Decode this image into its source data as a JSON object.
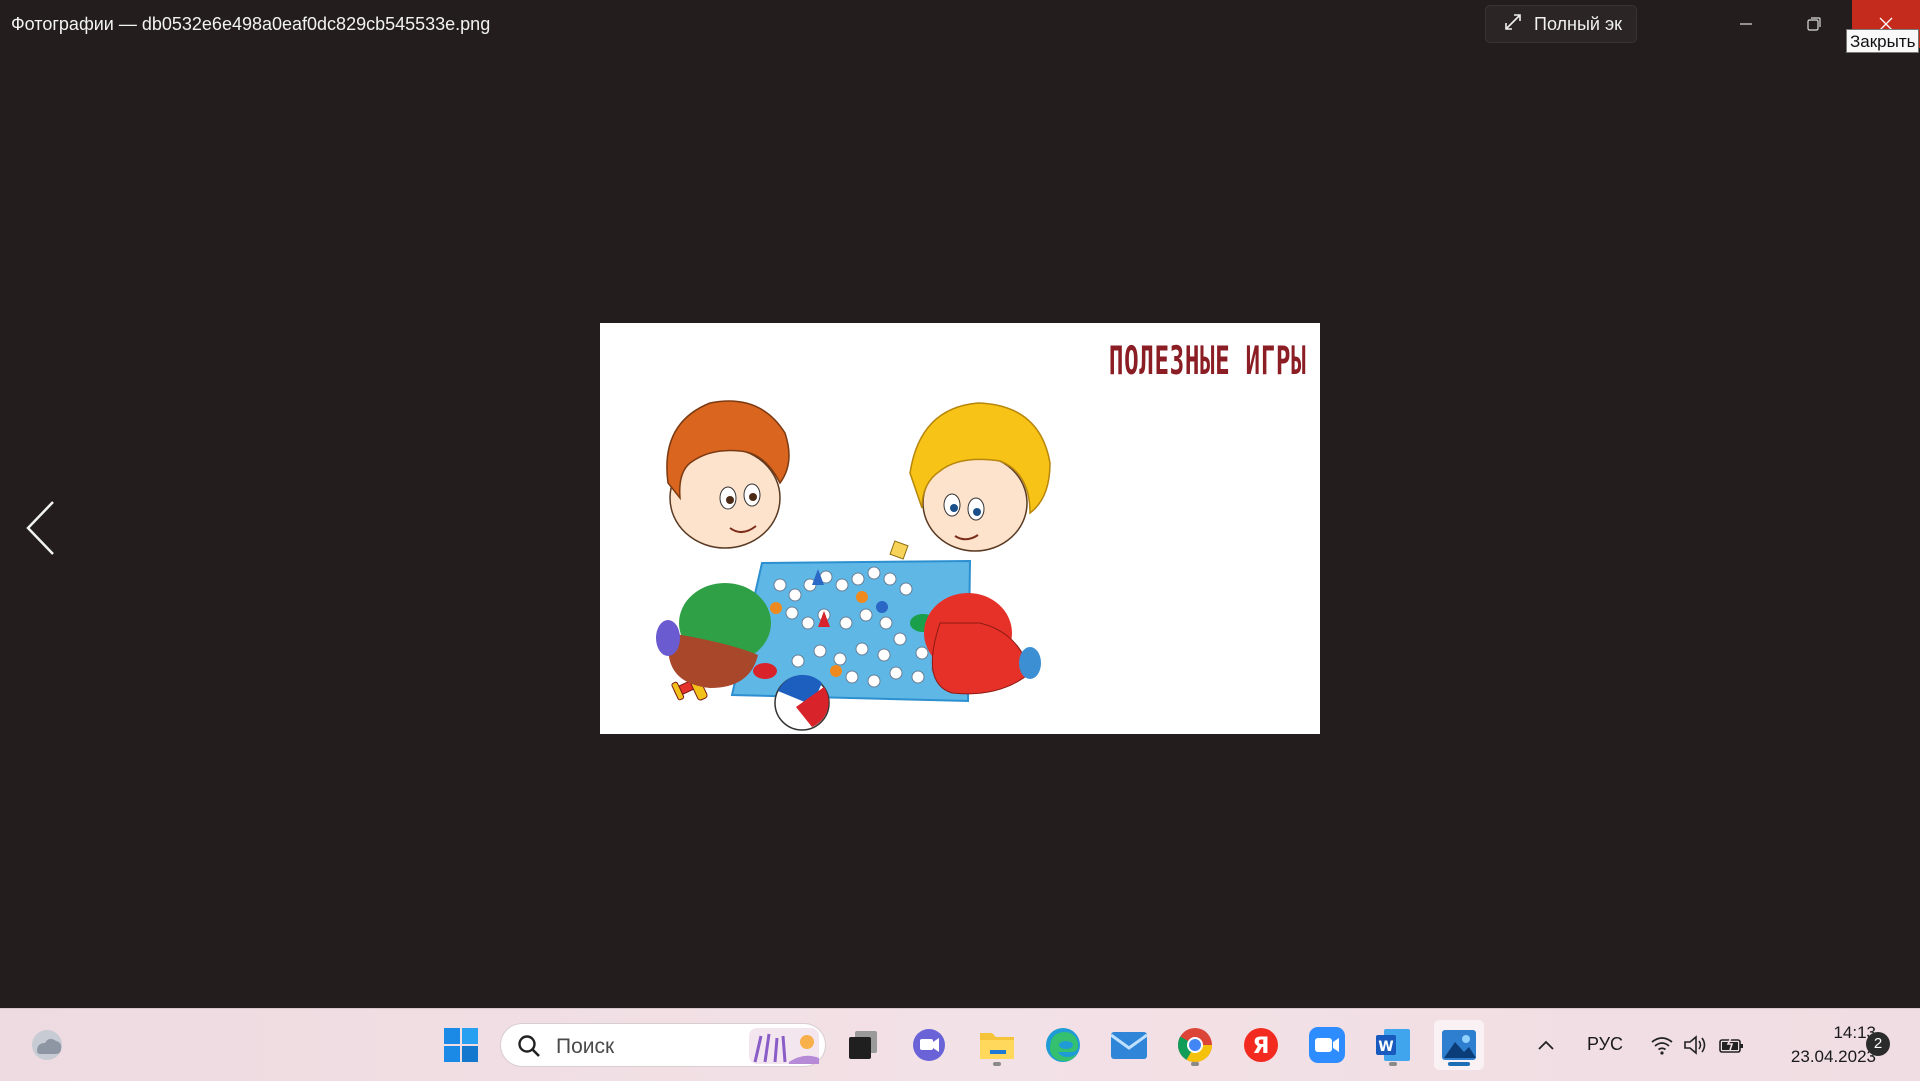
{
  "window": {
    "title": "Фотографии — db0532e6e498a0eaf0dc829cb545533e.png",
    "fullscreen_label": "Полный эк",
    "close_tooltip": "Закрыть"
  },
  "photo": {
    "heading": "ПОЛЕЗНЫЕ ИГРЫ"
  },
  "taskbar": {
    "search_placeholder": "Поиск",
    "language": "РУС",
    "time": "14:13",
    "date": "23.04.2023",
    "notification_count": "2"
  },
  "colors": {
    "background": "#231d1e",
    "close_red": "#c42b1c",
    "heading_red": "#8b1e24",
    "accent": "#1c6fb5"
  }
}
